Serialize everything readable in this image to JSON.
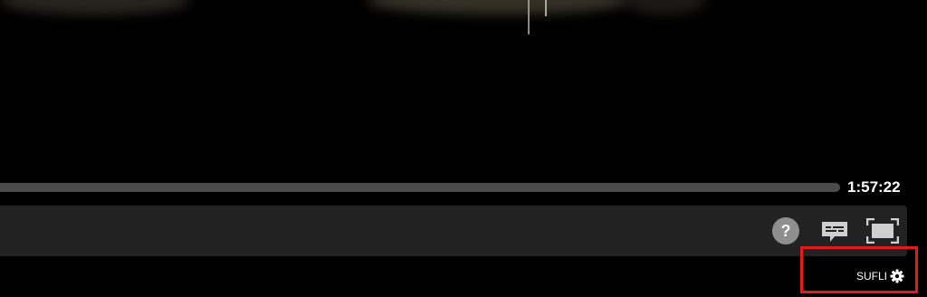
{
  "player": {
    "progress_fraction": 0.0,
    "duration": "1:57:22",
    "help_label": "?",
    "settings_label": "SUFLI"
  },
  "icons": {
    "help": "help-icon",
    "captions": "captions-icon",
    "fullscreen": "fullscreen-icon",
    "settings": "gear-icon"
  },
  "colors": {
    "background": "#000000",
    "control_bar": "#222222",
    "progress_track": "#4a4a4a",
    "help_circle": "#8e8e8e",
    "icon": "#cfcfcf",
    "highlight": "#e11c1c"
  }
}
